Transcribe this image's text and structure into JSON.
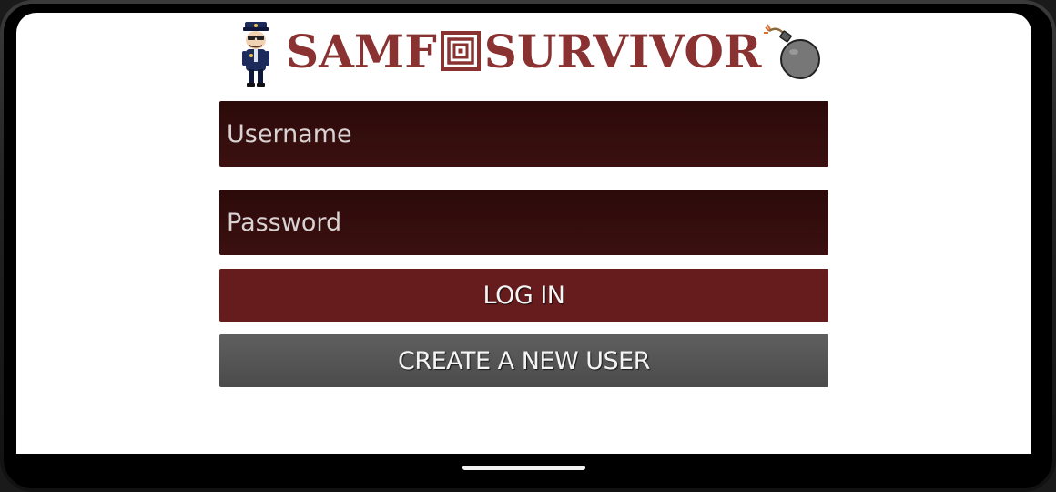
{
  "app": {
    "title_left": "SAMF",
    "title_right": "SURVIVOR",
    "title_color": "#8a3232"
  },
  "icons": {
    "left": "policeman-icon",
    "center": "concentric-squares-icon",
    "right": "bomb-icon"
  },
  "form": {
    "username_placeholder": "Username",
    "username_value": "",
    "password_placeholder": "Password",
    "password_value": ""
  },
  "buttons": {
    "login_label": "LOG IN",
    "create_label": "CREATE A NEW USER"
  },
  "colors": {
    "field_bg": "#331010",
    "login_bg": "#661c1c",
    "create_bg": "#555555"
  }
}
